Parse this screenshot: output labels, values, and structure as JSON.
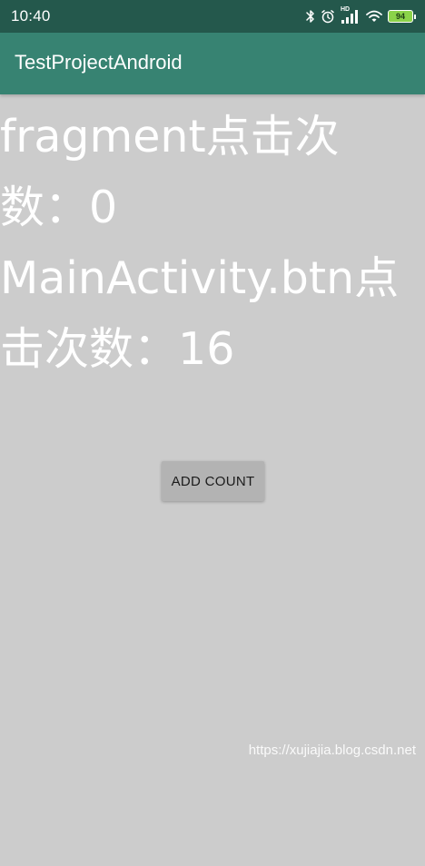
{
  "status_bar": {
    "time": "10:40",
    "icons": [
      "bluetooth-icon",
      "alarm-icon",
      "hd-signal-icon",
      "wifi-icon",
      "battery-icon"
    ],
    "signal_label": "HD",
    "battery_level": "94"
  },
  "app_bar": {
    "title": "TestProjectAndroid"
  },
  "main": {
    "fragment_label": "fragment点击次数：",
    "fragment_count": "0",
    "activity_label": "MainActivity.btn点击次数：",
    "activity_count": "16",
    "add_button_label": "ADD COUNT"
  },
  "watermark": "https://xujiajia.blog.csdn.net",
  "colors": {
    "status_bar_bg": "#24584c",
    "app_bar_bg": "#378372",
    "content_bg": "#cccccc",
    "button_bg": "#b3b3b3",
    "text_white": "#ffffff"
  }
}
